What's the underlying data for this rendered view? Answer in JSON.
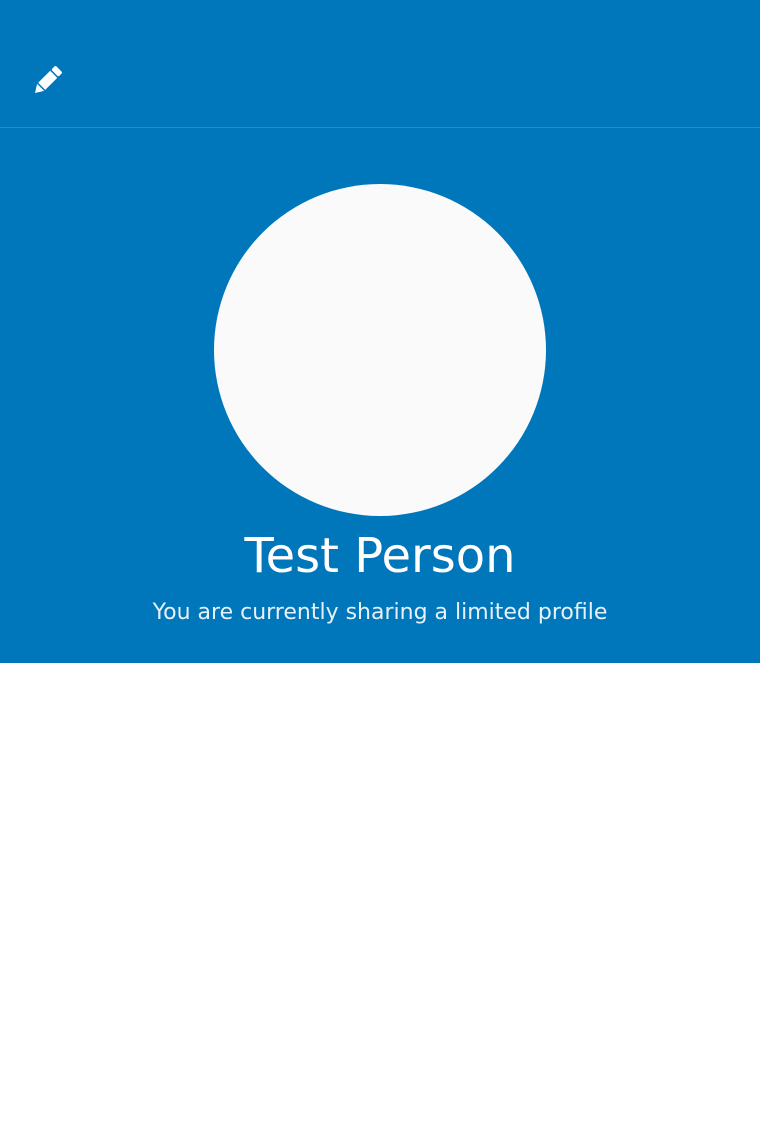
{
  "colors": {
    "brand": "#0077BB",
    "avatar_bg": "#FAFAFA",
    "text_on_brand": "#FFFFFF"
  },
  "toolbar": {
    "edit_icon": "pencil-icon"
  },
  "profile": {
    "name": "Test Person",
    "sharing_status": "You are currently sharing a limited profile"
  }
}
